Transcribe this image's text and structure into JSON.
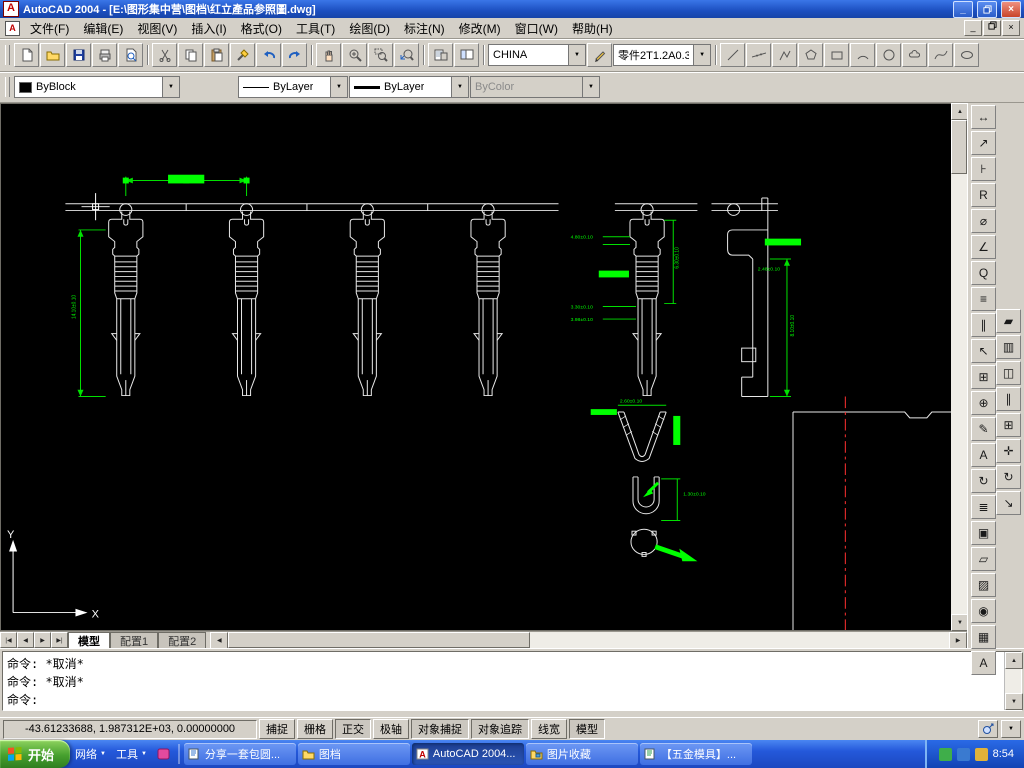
{
  "window": {
    "title": "AutoCAD 2004 - [E:\\图形集中营\\图档\\红立產品参照圖.dwg]"
  },
  "menu": {
    "items": [
      "文件(F)",
      "编辑(E)",
      "视图(V)",
      "插入(I)",
      "格式(O)",
      "工具(T)",
      "绘图(D)",
      "标注(N)",
      "修改(M)",
      "窗口(W)",
      "帮助(H)"
    ]
  },
  "toolbar": {
    "style_combo": "CHINA",
    "part_combo": "零件2T1.2A0.3"
  },
  "properties_bar": {
    "color": "ByBlock",
    "linetype": "ByLayer",
    "lineweight": "ByLayer",
    "plot_style": "ByColor"
  },
  "layout_tabs": [
    "模型",
    "配置1",
    "配置2"
  ],
  "command_window": {
    "lines": [
      "命令: *取消*",
      "命令: *取消*"
    ],
    "prompt": "命令:"
  },
  "status_bar": {
    "coordinates": "-43.61233688, 1.987312E+03, 0.00000000",
    "toggles": [
      "捕捉",
      "栅格",
      "正交",
      "极轴",
      "对象捕捉",
      "对象追踪",
      "线宽",
      "模型"
    ]
  },
  "taskbar": {
    "start": "开始",
    "quick_launch": [
      "网络",
      "工具"
    ],
    "tasks": [
      "分享一套包圆...",
      "图档",
      "AutoCAD 2004...",
      "图片收藏",
      "【五金模具】..."
    ],
    "clock": "8:54"
  },
  "drawing": {
    "ucs": {
      "x": "X",
      "y": "Y"
    },
    "dim_labels": [
      "4.80±0.10",
      "2.48±0.10",
      "3.30±0.10",
      "3.98±0.10",
      "8.10±0.10",
      "2.60±0.10",
      "1.30±0.10",
      "14.10±0.10",
      "6.30±0.10"
    ]
  },
  "icons": {
    "autocad": "A",
    "minimize": "_",
    "close": "×",
    "dropdown": "▼",
    "scroll_up": "▲",
    "scroll_down": "▼",
    "scroll_left": "◀",
    "scroll_right": "▶",
    "tab_first": "|◀",
    "tab_prev": "◀",
    "tab_next": "▶",
    "tab_last": "▶|",
    "dim_linear": "↔",
    "dim_aligned": "↗",
    "dim_ordinate": "⊦",
    "dim_radius": "R",
    "dim_diameter": "⌀",
    "dim_angular": "∠",
    "dim_quick": "Q",
    "dim_baseline": "≡",
    "dim_continue": "∥",
    "dim_leader": "↖",
    "dim_tolerance": "⊞",
    "dim_center_mark": "⊕",
    "dim_edit": "✎",
    "dim_text_edit": "A",
    "dim_update": "↻",
    "dim_style": "≣",
    "make_block": "▣",
    "insert_block": "▱",
    "hatch_tool": "▨",
    "region_tool": "◉",
    "table_tool": "▦",
    "text_tool": "A",
    "erase": "▰",
    "copy_obj": "▥",
    "mirror": "◫",
    "offset": "∥",
    "array": "⊞",
    "move": "✛",
    "rotate": "↻",
    "scale": "↘"
  },
  "colors": {
    "dimension": "#00e000",
    "dimension_bright": "#00ff00",
    "geometry": "#e8e8e8",
    "centerline": "#ff3030",
    "canvas": "#000000"
  }
}
